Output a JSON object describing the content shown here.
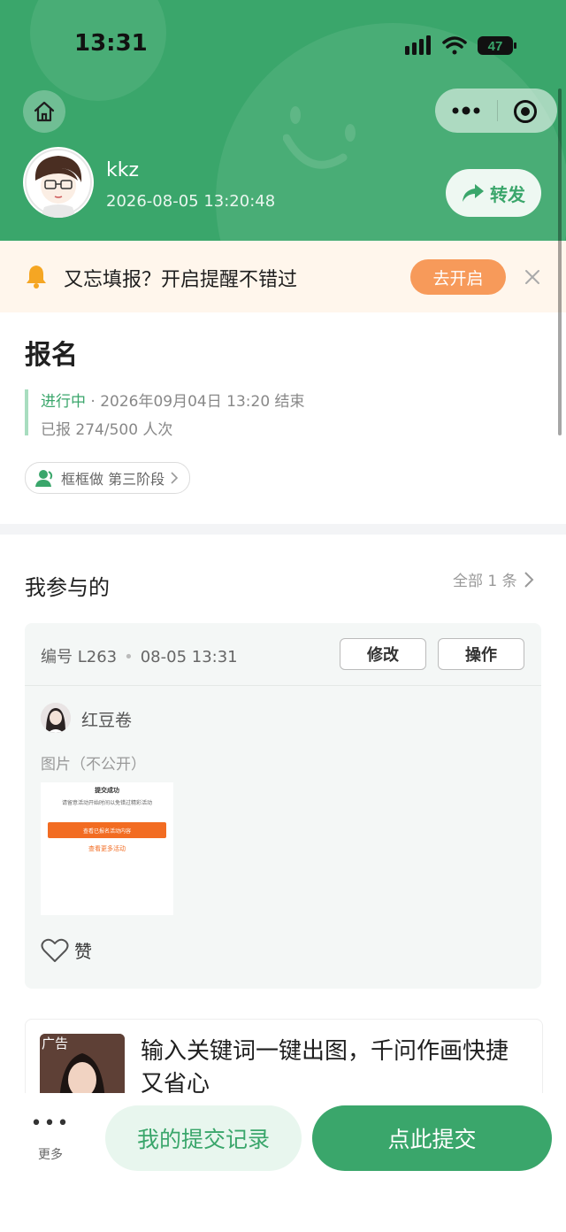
{
  "status_bar": {
    "time": "13:31",
    "battery": "47"
  },
  "header": {
    "user_name": "kkz",
    "timestamp": "2026-08-05 13:20:48",
    "share_label": "转发",
    "bg_color": "#3aa66b"
  },
  "reminder": {
    "text": "又忘填报？开启提醒不错过",
    "button": "去开启"
  },
  "activity": {
    "title": "报名",
    "status": "进行中",
    "end_info": " · 2026年09月04日 13:20 结束",
    "count": "已报 274/500 人次",
    "tag": "框框做 第三阶段"
  },
  "participation": {
    "title": "我参与的",
    "all_label": "全部 1 条",
    "card": {
      "id_label": "编号 L263",
      "time": "08-05 13:31",
      "edit_button": "修改",
      "action_button": "操作",
      "user": "红豆卷",
      "image_label": "图片（不公开）",
      "thumb": {
        "title": "提交成功",
        "subtitle": "请留意活动开始时间以免错过精彩活动",
        "primary": "查看已报名活动内容",
        "secondary": "查看更多活动"
      },
      "like_label": "赞"
    }
  },
  "ad": {
    "tag": "广告",
    "text": "输入关键词一键出图，千问作画快捷又省心"
  },
  "bottom_bar": {
    "more_label": "更多",
    "records_button": "我的提交记录",
    "submit_button": "点此提交"
  },
  "icons": [
    "home-icon",
    "more-dots-icon",
    "target-icon",
    "share-icon",
    "bell-icon",
    "close-icon",
    "user-icon",
    "chevron-right-icon",
    "heart-icon",
    "signal-icon",
    "wifi-icon",
    "battery-icon"
  ]
}
